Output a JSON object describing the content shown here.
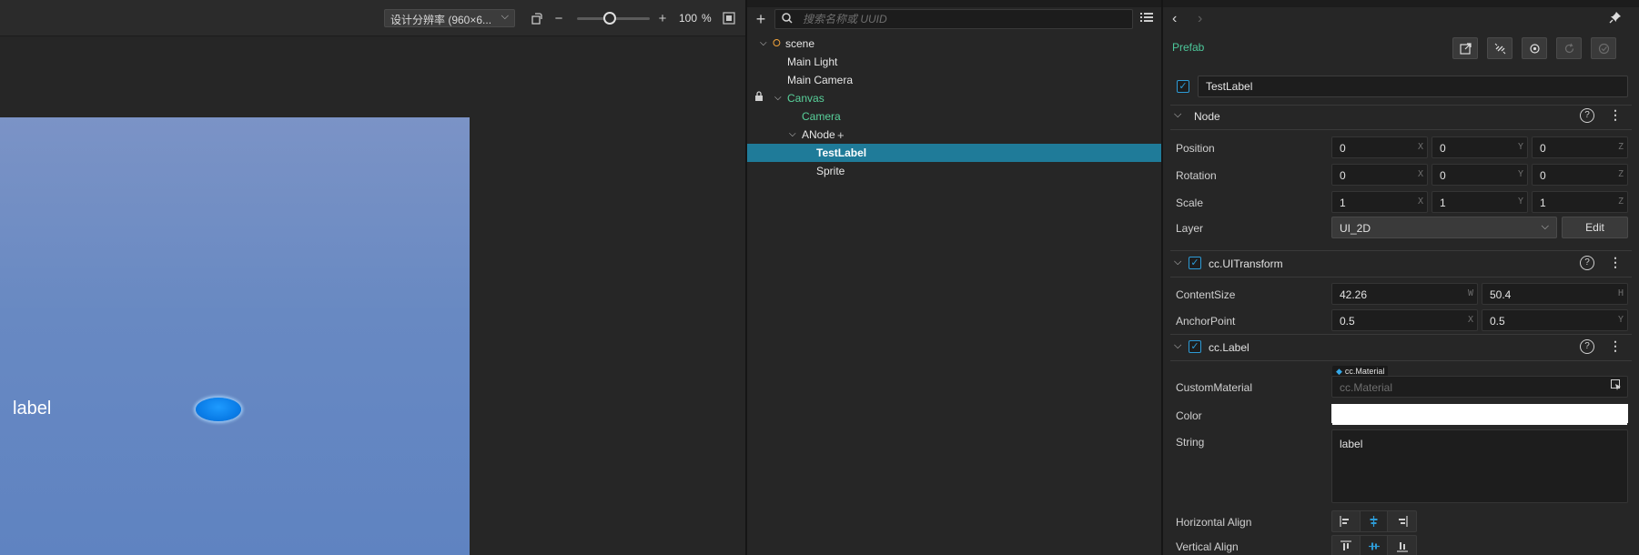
{
  "scene": {
    "resolution_label": "设计分辨率 (960×6...",
    "zoom_value": "100",
    "zoom_unit": "%",
    "zoom_level_fraction": 0.45,
    "canvas": {
      "label_text": "label"
    },
    "icons": {
      "resolution_dropdown": "chevron-down-icon",
      "aspect": "rotate-screen-icon",
      "zoom_out": "minus-icon",
      "zoom_in": "plus-icon",
      "fit": "fit-screen-icon"
    }
  },
  "hierarchy": {
    "search_placeholder": "搜索名称或 UUID",
    "icons": {
      "add": "plus-icon",
      "search": "search-icon",
      "menu": "list-menu-icon"
    },
    "nodes": [
      {
        "label": "scene",
        "depth": 0,
        "expanded": true,
        "icon": "scene-fire-icon"
      },
      {
        "label": "Main Light",
        "depth": 1
      },
      {
        "label": "Main Camera",
        "depth": 1
      },
      {
        "label": "Canvas",
        "depth": 1,
        "expanded": true,
        "locked": true,
        "color": "#58d09a"
      },
      {
        "label": "Camera",
        "depth": 2,
        "color": "#58d09a"
      },
      {
        "label": "ANode",
        "depth": 2,
        "expanded": true,
        "suffix": "+"
      },
      {
        "label": "TestLabel",
        "depth": 3,
        "selected": true
      },
      {
        "label": "Sprite",
        "depth": 3
      }
    ]
  },
  "inspector": {
    "prefab_label": "Prefab",
    "node_enabled": true,
    "node_name": "TestLabel",
    "node_section": {
      "title": "Node",
      "properties": [
        {
          "label": "Position",
          "values": [
            {
              "v": "0",
              "axis": "X"
            },
            {
              "v": "0",
              "axis": "Y"
            },
            {
              "v": "0",
              "axis": "Z"
            }
          ]
        },
        {
          "label": "Rotation",
          "values": [
            {
              "v": "0",
              "axis": "X"
            },
            {
              "v": "0",
              "axis": "Y"
            },
            {
              "v": "0",
              "axis": "Z"
            }
          ]
        },
        {
          "label": "Scale",
          "values": [
            {
              "v": "1",
              "axis": "X"
            },
            {
              "v": "1",
              "axis": "Y"
            },
            {
              "v": "1",
              "axis": "Z"
            }
          ]
        }
      ],
      "layer_label": "Layer",
      "layer_value": "UI_2D",
      "layer_edit": "Edit"
    },
    "uitransform_section": {
      "title": "cc.UITransform",
      "enabled": true,
      "properties": [
        {
          "label": "ContentSize",
          "values": [
            {
              "v": "42.26",
              "axis": "W"
            },
            {
              "v": "50.4",
              "axis": "H"
            }
          ]
        },
        {
          "label": "AnchorPoint",
          "values": [
            {
              "v": "0.5",
              "axis": "X"
            },
            {
              "v": "0.5",
              "axis": "Y"
            }
          ]
        }
      ]
    },
    "label_section": {
      "title": "cc.Label",
      "enabled": true,
      "custom_material_label": "CustomMaterial",
      "material_tag": "cc.Material",
      "material_placeholder": "cc.Material",
      "color_label": "Color",
      "color_value": "#ffffff",
      "string_label": "String",
      "string_value": "label",
      "horizontal_align_label": "Horizontal Align",
      "vertical_align_label": "Vertical Align",
      "horizontal_align_selected": 1,
      "vertical_align_selected": 1
    },
    "icons": {
      "back": "chevron-left-icon",
      "forward": "chevron-right-icon",
      "pin": "pin-icon",
      "help": "help-circle-icon",
      "more": "more-vertical-icon",
      "prefab_buttons": [
        "open-prefab-icon",
        "unlink-prefab-icon",
        "locate-prefab-icon",
        "revert-prefab-icon",
        "apply-prefab-icon"
      ]
    }
  },
  "colors": {
    "accent_blue": "#2d9bd6",
    "selection": "#1f7b99",
    "prefab_green": "#4cc79a",
    "canvas_bg": "#6889c2"
  }
}
